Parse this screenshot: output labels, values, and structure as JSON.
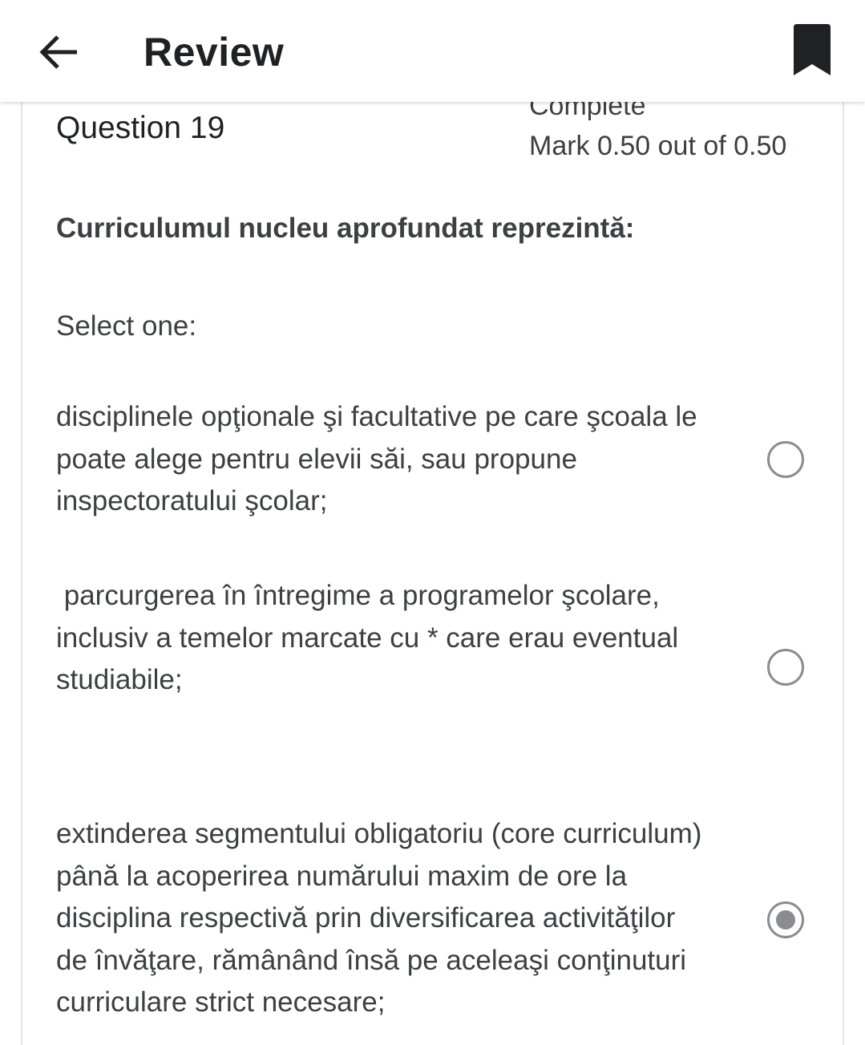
{
  "header": {
    "title": "Review",
    "back_icon": "arrow-left-icon",
    "bookmark_icon": "bookmark-icon"
  },
  "question": {
    "label": "Question 19",
    "state": "Complete",
    "mark": "Mark 0.50 out of 0.50",
    "text": "Curriculumul nucleu aprofundat reprezintă:",
    "prompt": "Select one:"
  },
  "options": [
    {
      "text": "disciplinele opţionale şi facultative pe care şcoala le poate alege pentru elevii săi, sau propune inspectoratului şcolar;",
      "selected": false
    },
    {
      "text": " parcurgerea în întregime a programelor şcolare, inclusiv a temelor marcate cu * care erau eventual studiabile;",
      "selected": false
    },
    {
      "text": "extinderea segmentului obligatoriu (core curriculum) până la acoperirea numărului maxim de ore la disciplina respectivă prin diversificarea activităţilor de învăţare, rămânând însă pe aceleaşi conţinuturi curriculare strict necesare;",
      "selected": true
    }
  ],
  "colors": {
    "text": "#3c4043",
    "title": "#1f2124",
    "radio": "#8a8c90",
    "card_border": "#e3e5e8"
  }
}
